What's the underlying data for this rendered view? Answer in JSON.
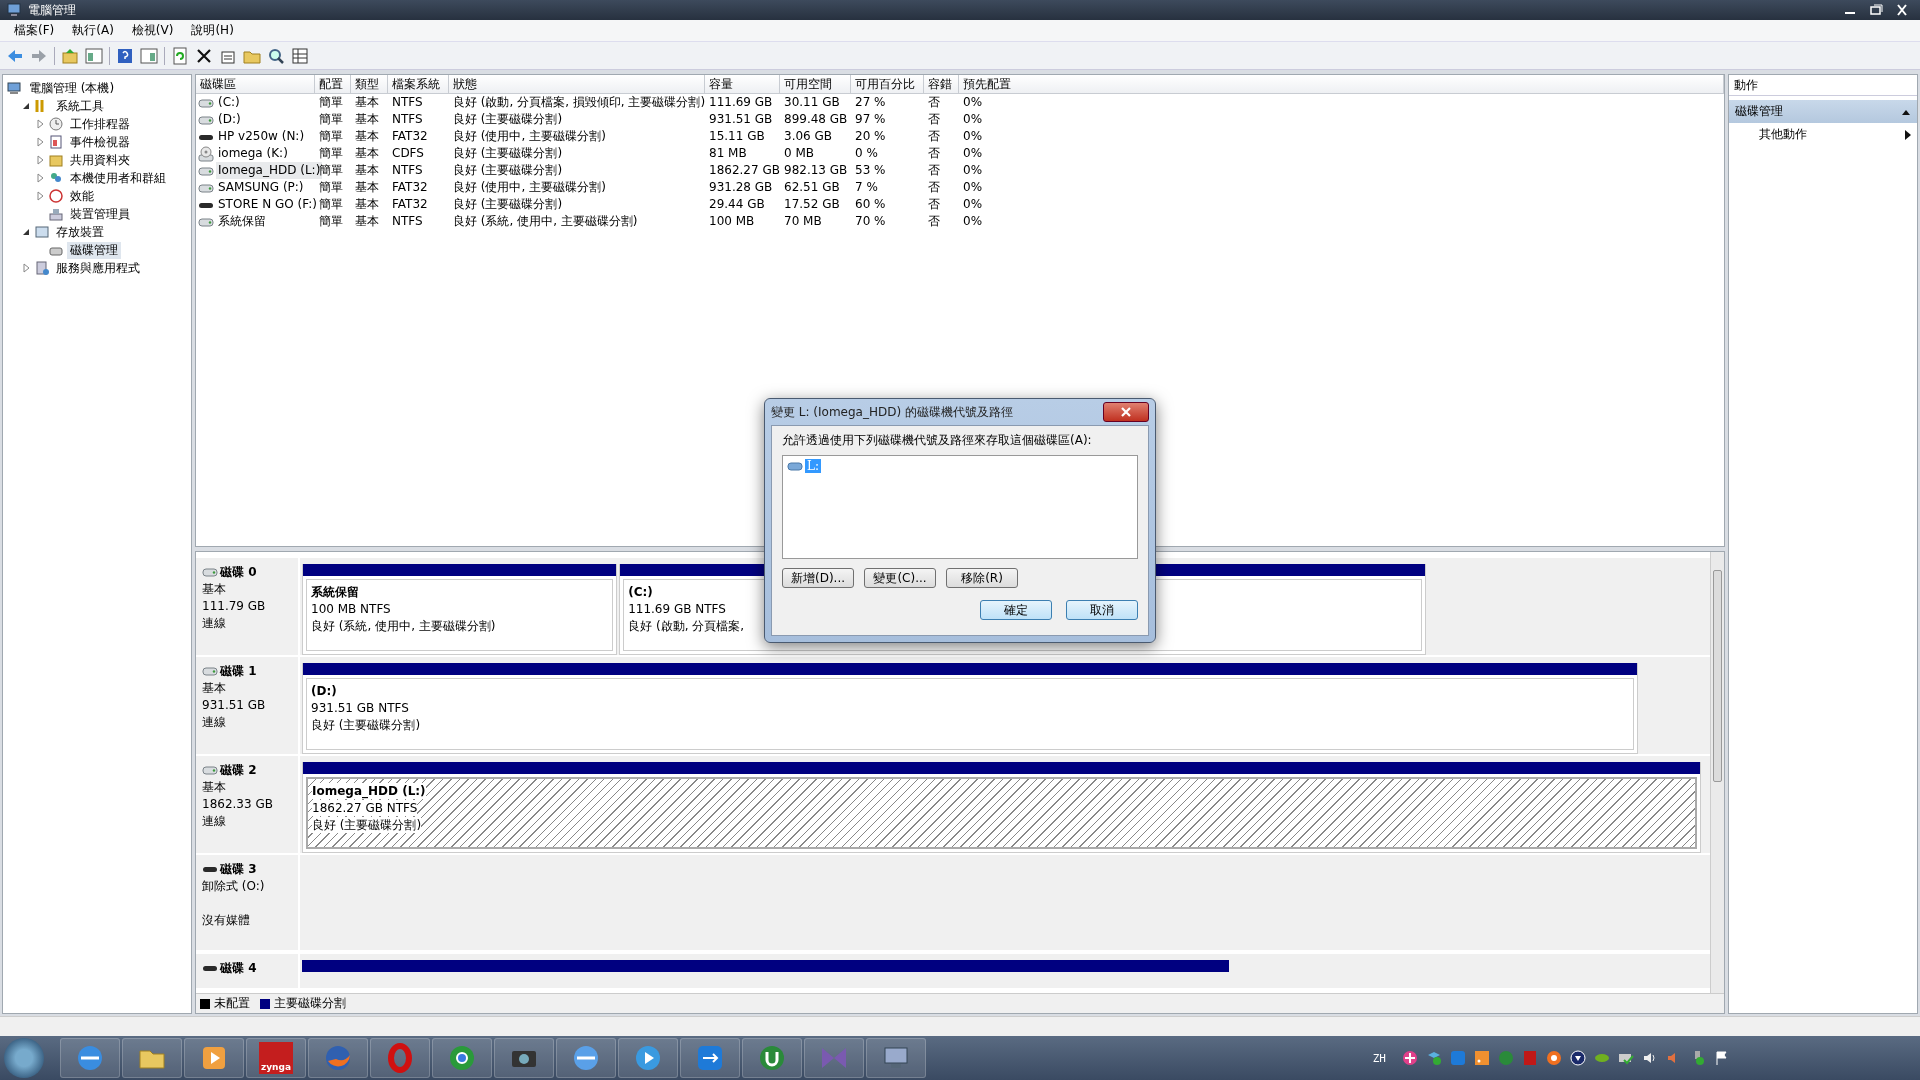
{
  "window": {
    "title": "電腦管理"
  },
  "menu": [
    "檔案(F)",
    "執行(A)",
    "檢視(V)",
    "說明(H)"
  ],
  "tree": {
    "label": "電腦管理 (本機)",
    "selected": false,
    "children": [
      {
        "label": "系統工具",
        "expanded": true,
        "selected": false,
        "children": [
          {
            "label": "工作排程器",
            "expanded": false,
            "selected": false
          },
          {
            "label": "事件檢視器",
            "expanded": false,
            "selected": false
          },
          {
            "label": "共用資料夾",
            "expanded": false,
            "selected": false
          },
          {
            "label": "本機使用者和群組",
            "expanded": false,
            "selected": false
          },
          {
            "label": "效能",
            "expanded": false,
            "selected": false
          },
          {
            "label": "裝置管理員",
            "selected": false
          }
        ]
      },
      {
        "label": "存放裝置",
        "expanded": true,
        "selected": false,
        "children": [
          {
            "label": "磁碟管理",
            "selected": true
          }
        ]
      },
      {
        "label": "服務與應用程式",
        "expanded": false,
        "selected": false
      }
    ]
  },
  "volumes": {
    "columns": [
      "磁碟區",
      "配置",
      "類型",
      "檔案系統",
      "狀態",
      "容量",
      "可用空間",
      "可用百分比",
      "容錯",
      "預先配置"
    ],
    "rows": [
      {
        "kind": "disk",
        "selected": false,
        "cells": [
          "(C:)",
          "簡單",
          "基本",
          "NTFS",
          "良好 (啟動, 分頁檔案, 損毀傾印, 主要磁碟分割)",
          "111.69 GB",
          "30.11 GB",
          "27 %",
          "否",
          "0%"
        ]
      },
      {
        "kind": "disk",
        "selected": false,
        "cells": [
          "(D:)",
          "簡單",
          "基本",
          "NTFS",
          "良好 (主要磁碟分割)",
          "931.51 GB",
          "899.48 GB",
          "97 %",
          "否",
          "0%"
        ]
      },
      {
        "kind": "removable",
        "selected": false,
        "cells": [
          "HP v250w (N:)",
          "簡單",
          "基本",
          "FAT32",
          "良好 (使用中, 主要磁碟分割)",
          "15.11 GB",
          "3.06 GB",
          "20 %",
          "否",
          "0%"
        ]
      },
      {
        "kind": "cdrom",
        "selected": false,
        "cells": [
          "iomega (K:)",
          "簡單",
          "基本",
          "CDFS",
          "良好 (主要磁碟分割)",
          "81 MB",
          "0 MB",
          "0 %",
          "否",
          "0%"
        ]
      },
      {
        "kind": "disk",
        "selected": true,
        "cells": [
          "Iomega_HDD (L:)",
          "簡單",
          "基本",
          "NTFS",
          "良好 (主要磁碟分割)",
          "1862.27 GB",
          "982.13 GB",
          "53 %",
          "否",
          "0%"
        ]
      },
      {
        "kind": "disk",
        "selected": false,
        "cells": [
          "SAMSUNG (P:)",
          "簡單",
          "基本",
          "FAT32",
          "良好 (使用中, 主要磁碟分割)",
          "931.28 GB",
          "62.51 GB",
          "7 %",
          "否",
          "0%"
        ]
      },
      {
        "kind": "removable",
        "selected": false,
        "cells": [
          "STORE N GO (F:)",
          "簡單",
          "基本",
          "FAT32",
          "良好 (主要磁碟分割)",
          "29.44 GB",
          "17.52 GB",
          "60 %",
          "否",
          "0%"
        ]
      },
      {
        "kind": "disk",
        "selected": false,
        "cells": [
          "系統保留",
          "簡單",
          "基本",
          "NTFS",
          "良好 (系統, 使用中, 主要磁碟分割)",
          "100 MB",
          "70 MB",
          "70 %",
          "否",
          "0%"
        ]
      }
    ]
  },
  "disks": [
    {
      "name": "磁碟 0",
      "kind": "disk",
      "type": "基本",
      "size": "111.79 GB",
      "status": "連線",
      "partitions": [
        {
          "kind": "primary",
          "selected": false,
          "name": "系統保留",
          "size": "100 MB NTFS",
          "status": "良好 (系統, 使用中, 主要磁碟分割)"
        },
        {
          "kind": "primary",
          "selected": false,
          "name": "(C:)",
          "size": "111.69 GB NTFS",
          "status": "良好 (啟動, 分頁檔案,"
        }
      ]
    },
    {
      "name": "磁碟 1",
      "kind": "disk",
      "type": "基本",
      "size": "931.51 GB",
      "status": "連線",
      "partitions": [
        {
          "kind": "primary",
          "selected": false,
          "name": "(D:)",
          "size": "931.51 GB NTFS",
          "status": "良好 (主要磁碟分割)"
        }
      ]
    },
    {
      "name": "磁碟 2",
      "kind": "disk",
      "type": "基本",
      "size": "1862.33 GB",
      "status": "連線",
      "partitions": [
        {
          "kind": "primary",
          "selected": true,
          "name": "Iomega_HDD  (L:)",
          "size": "1862.27 GB NTFS",
          "status": "良好 (主要磁碟分割)"
        }
      ]
    },
    {
      "name": "磁碟 3",
      "kind": "removable",
      "type": "卸除式 (O:)",
      "status": "沒有媒體"
    },
    {
      "name": "磁碟 4",
      "kind": "removable",
      "partitions": [
        {
          "kind": "primary",
          "selected": false
        }
      ]
    }
  ],
  "legend": [
    {
      "label": "未配置",
      "color": "#000000"
    },
    {
      "label": "主要磁碟分割",
      "color": "#000080"
    }
  ],
  "actions": {
    "title": "動作",
    "sections": [
      {
        "label": "磁碟管理",
        "expanded": true,
        "items": [
          {
            "label": "其他動作",
            "submenu": true
          }
        ]
      }
    ]
  },
  "dialog": {
    "title": "變更 L: (Iomega_HDD) 的磁碟機代號及路徑",
    "prompt": "允許透過使用下列磁碟機代號及路徑來存取這個磁碟區(A):",
    "entries": [
      {
        "label": "L:",
        "selected": true
      }
    ],
    "buttons": [
      "新增(D)...",
      "變更(C)...",
      "移除(R)"
    ],
    "footer_buttons": [
      "確定",
      "取消"
    ]
  },
  "taskbar": {
    "app_label": "zynga",
    "input_language": "ZH"
  }
}
